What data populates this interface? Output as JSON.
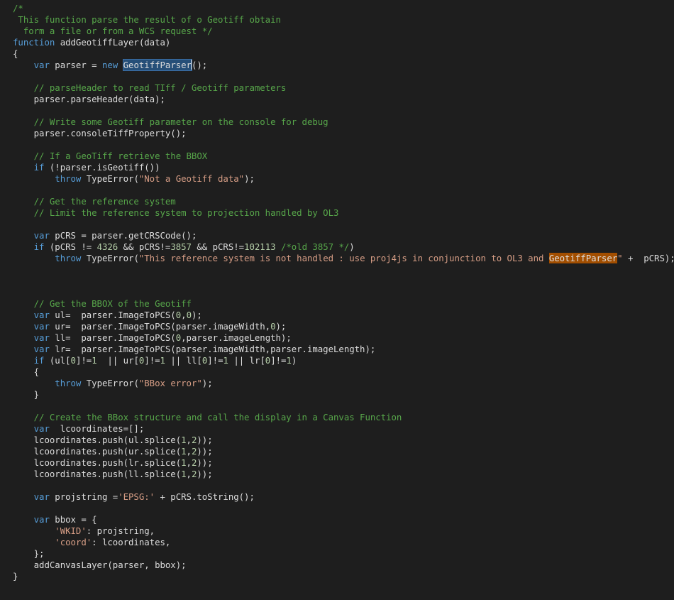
{
  "editor": {
    "lines": [
      [
        [
          "cm",
          "/*"
        ]
      ],
      [
        [
          "cm",
          " This function parse the result of o Geotiff obtain"
        ]
      ],
      [
        [
          "cm",
          "  form a file or from a WCS request */"
        ]
      ],
      [
        [
          "kw",
          "function"
        ],
        [
          "pl",
          " addGeotiffLayer(data)"
        ]
      ],
      [
        [
          "pl",
          "{"
        ]
      ],
      [
        [
          "pl",
          "    "
        ],
        [
          "kw",
          "var"
        ],
        [
          "pl",
          " parser = "
        ],
        [
          "kw",
          "new"
        ],
        [
          "pl",
          " "
        ],
        [
          "sel",
          "GeotiffParser"
        ],
        [
          "caret",
          ""
        ],
        [
          "pl",
          "();"
        ]
      ],
      [],
      [
        [
          "pl",
          "    "
        ],
        [
          "cm",
          "// parseHeader to read TIff / Geotiff parameters"
        ]
      ],
      [
        [
          "pl",
          "    parser.parseHeader(data);"
        ]
      ],
      [],
      [
        [
          "pl",
          "    "
        ],
        [
          "cm",
          "// Write some Geotiff parameter on the console for debug"
        ]
      ],
      [
        [
          "pl",
          "    parser.consoleTiffProperty();"
        ]
      ],
      [],
      [
        [
          "pl",
          "    "
        ],
        [
          "cm",
          "// If a GeoTiff retrieve the BBOX"
        ]
      ],
      [
        [
          "pl",
          "    "
        ],
        [
          "kw",
          "if"
        ],
        [
          "pl",
          " (!parser.isGeotiff())"
        ]
      ],
      [
        [
          "pl",
          "        "
        ],
        [
          "kw",
          "throw"
        ],
        [
          "pl",
          " TypeError("
        ],
        [
          "str",
          "\"Not a Geotiff data\""
        ],
        [
          "pl",
          ");"
        ]
      ],
      [],
      [
        [
          "pl",
          "    "
        ],
        [
          "cm",
          "// Get the reference system"
        ]
      ],
      [
        [
          "pl",
          "    "
        ],
        [
          "cm",
          "// Limit the reference system to projection handled by OL3"
        ]
      ],
      [],
      [
        [
          "pl",
          "    "
        ],
        [
          "kw",
          "var"
        ],
        [
          "pl",
          " pCRS = parser.getCRSCode();"
        ]
      ],
      [
        [
          "pl",
          "    "
        ],
        [
          "kw",
          "if"
        ],
        [
          "pl",
          " (pCRS != "
        ],
        [
          "num",
          "4326"
        ],
        [
          "pl",
          " && pCRS!="
        ],
        [
          "num",
          "3857"
        ],
        [
          "pl",
          " && pCRS!="
        ],
        [
          "num",
          "102113"
        ],
        [
          "pl",
          " "
        ],
        [
          "cm",
          "/*old 3857 */"
        ],
        [
          "pl",
          ")"
        ]
      ],
      [
        [
          "pl",
          "        "
        ],
        [
          "kw",
          "throw"
        ],
        [
          "pl",
          " TypeError("
        ],
        [
          "str",
          "\"This reference system is not handled : use proj4js in conjunction to OL3 and "
        ],
        [
          "find",
          "GeotiffParser"
        ],
        [
          "str",
          "\""
        ],
        [
          "pl",
          " +  pCRS);"
        ]
      ],
      [],
      [],
      [],
      [
        [
          "pl",
          "    "
        ],
        [
          "cm",
          "// Get the BBOX of the Geotiff"
        ]
      ],
      [
        [
          "pl",
          "    "
        ],
        [
          "kw",
          "var"
        ],
        [
          "pl",
          " ul=  parser.ImageToPCS("
        ],
        [
          "num",
          "0"
        ],
        [
          "pl",
          ","
        ],
        [
          "num",
          "0"
        ],
        [
          "pl",
          ");"
        ]
      ],
      [
        [
          "pl",
          "    "
        ],
        [
          "kw",
          "var"
        ],
        [
          "pl",
          " ur=  parser.ImageToPCS(parser.imageWidth,"
        ],
        [
          "num",
          "0"
        ],
        [
          "pl",
          ");"
        ]
      ],
      [
        [
          "pl",
          "    "
        ],
        [
          "kw",
          "var"
        ],
        [
          "pl",
          " ll=  parser.ImageToPCS("
        ],
        [
          "num",
          "0"
        ],
        [
          "pl",
          ",parser.imageLength);"
        ]
      ],
      [
        [
          "pl",
          "    "
        ],
        [
          "kw",
          "var"
        ],
        [
          "pl",
          " lr=  parser.ImageToPCS(parser.imageWidth,parser.imageLength);"
        ]
      ],
      [
        [
          "pl",
          "    "
        ],
        [
          "kw",
          "if"
        ],
        [
          "pl",
          " (ul["
        ],
        [
          "num",
          "0"
        ],
        [
          "pl",
          "]!="
        ],
        [
          "num",
          "1"
        ],
        [
          "pl",
          "  || ur["
        ],
        [
          "num",
          "0"
        ],
        [
          "pl",
          "]!="
        ],
        [
          "num",
          "1"
        ],
        [
          "pl",
          " || ll["
        ],
        [
          "num",
          "0"
        ],
        [
          "pl",
          "]!="
        ],
        [
          "num",
          "1"
        ],
        [
          "pl",
          " || lr["
        ],
        [
          "num",
          "0"
        ],
        [
          "pl",
          "]!="
        ],
        [
          "num",
          "1"
        ],
        [
          "pl",
          ")"
        ]
      ],
      [
        [
          "pl",
          "    {"
        ]
      ],
      [
        [
          "pl",
          "        "
        ],
        [
          "kw",
          "throw"
        ],
        [
          "pl",
          " TypeError("
        ],
        [
          "str",
          "\"BBox error\""
        ],
        [
          "pl",
          ");"
        ]
      ],
      [
        [
          "pl",
          "    }"
        ]
      ],
      [],
      [
        [
          "pl",
          "    "
        ],
        [
          "cm",
          "// Create the BBox structure and call the display in a Canvas Function"
        ]
      ],
      [
        [
          "pl",
          "    "
        ],
        [
          "kw",
          "var"
        ],
        [
          "pl",
          "  lcoordinates=[];"
        ]
      ],
      [
        [
          "pl",
          "    lcoordinates.push(ul.splice("
        ],
        [
          "num",
          "1"
        ],
        [
          "pl",
          ","
        ],
        [
          "num",
          "2"
        ],
        [
          "pl",
          "));"
        ]
      ],
      [
        [
          "pl",
          "    lcoordinates.push(ur.splice("
        ],
        [
          "num",
          "1"
        ],
        [
          "pl",
          ","
        ],
        [
          "num",
          "2"
        ],
        [
          "pl",
          "));"
        ]
      ],
      [
        [
          "pl",
          "    lcoordinates.push(lr.splice("
        ],
        [
          "num",
          "1"
        ],
        [
          "pl",
          ","
        ],
        [
          "num",
          "2"
        ],
        [
          "pl",
          "));"
        ]
      ],
      [
        [
          "pl",
          "    lcoordinates.push(ll.splice("
        ],
        [
          "num",
          "1"
        ],
        [
          "pl",
          ","
        ],
        [
          "num",
          "2"
        ],
        [
          "pl",
          "));"
        ]
      ],
      [],
      [
        [
          "pl",
          "    "
        ],
        [
          "kw",
          "var"
        ],
        [
          "pl",
          " projstring ="
        ],
        [
          "str",
          "'EPSG:'"
        ],
        [
          "pl",
          " + pCRS.toString();"
        ]
      ],
      [],
      [
        [
          "pl",
          "    "
        ],
        [
          "kw",
          "var"
        ],
        [
          "pl",
          " bbox = {"
        ]
      ],
      [
        [
          "pl",
          "        "
        ],
        [
          "str",
          "'WKID'"
        ],
        [
          "pl",
          ": projstring,"
        ]
      ],
      [
        [
          "pl",
          "        "
        ],
        [
          "str",
          "'coord'"
        ],
        [
          "pl",
          ": lcoordinates,"
        ]
      ],
      [
        [
          "pl",
          "    };"
        ]
      ],
      [
        [
          "pl",
          "    addCanvasLayer(parser, bbox);"
        ]
      ],
      [
        [
          "pl",
          "}"
        ]
      ]
    ]
  },
  "colors": {
    "background": "#1e1e1e",
    "keyword": "#569cd6",
    "comment": "#57a64a",
    "string": "#d69d85",
    "number": "#b5cea8",
    "plain": "#dcdcdc",
    "selection": "#264f78",
    "find_highlight": "#a24e00"
  }
}
